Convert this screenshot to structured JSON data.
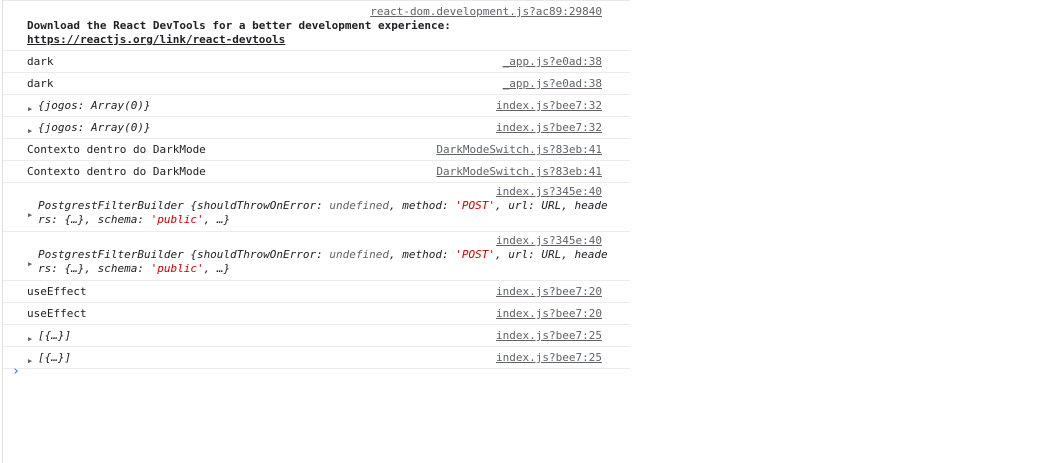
{
  "console": {
    "entries": [
      {
        "source": "react-dom.development.js?ac89:29840",
        "msg_prefix": "Download the React DevTools for a better development experience: ",
        "link": "https://reactjs.org/link/react-devtools"
      },
      {
        "msg": "dark",
        "source": "_app.js?e0ad:38"
      },
      {
        "msg": "dark",
        "source": "_app.js?e0ad:38"
      },
      {
        "msg": "{jogos: Array(0)}",
        "source": "index.js?bee7:32"
      },
      {
        "msg": "{jogos: Array(0)}",
        "source": "index.js?bee7:32"
      },
      {
        "msg": "Contexto dentro do DarkMode",
        "source": "DarkModeSwitch.js?83eb:41"
      },
      {
        "msg": "Contexto dentro do DarkMode",
        "source": "DarkModeSwitch.js?83eb:41"
      },
      {
        "source": "index.js?345e:40",
        "p1": "PostgrestFilterBuilder {shouldThrowOnError: ",
        "k1": "undefined",
        "p2": ", method: ",
        "s1": "'POST'",
        "p3": ", url: URL, heade",
        "p4": "rs: {…}, schema: ",
        "s2": "'public'",
        "p5": ", …}"
      },
      {
        "source": "index.js?345e:40",
        "p1": "PostgrestFilterBuilder {shouldThrowOnError: ",
        "k1": "undefined",
        "p2": ", method: ",
        "s1": "'POST'",
        "p3": ", url: URL, heade",
        "p4": "rs: {…}, schema: ",
        "s2": "'public'",
        "p5": ", …}"
      },
      {
        "msg": "useEffect",
        "source": "index.js?bee7:20"
      },
      {
        "msg": "useEffect",
        "source": "index.js?bee7:20"
      },
      {
        "msg": "[{…}]",
        "source": "index.js?bee7:25"
      },
      {
        "msg": "[{…}]",
        "source": "index.js?bee7:25"
      }
    ],
    "expand_icon": "triangle-right-icon",
    "prompt_icon": "chevron-right-icon",
    "prompt_glyph": "›"
  }
}
